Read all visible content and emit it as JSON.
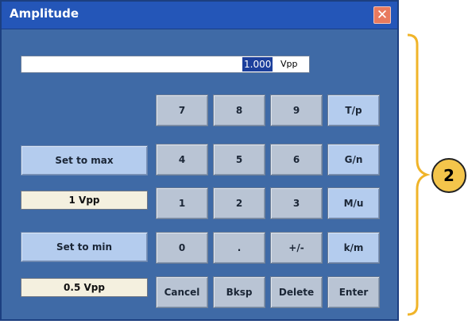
{
  "dialog": {
    "title": "Amplitude",
    "close_glyph": "✕",
    "input": {
      "value": "1.000",
      "unit": "Vpp"
    },
    "keypad": {
      "row1": [
        "7",
        "8",
        "9"
      ],
      "row2": [
        "4",
        "5",
        "6"
      ],
      "row3": [
        "1",
        "2",
        "3"
      ],
      "row4": [
        "0",
        ".",
        "+/-"
      ],
      "units": [
        "T/p",
        "G/n",
        "M/u",
        "k/m"
      ],
      "actions": [
        "Cancel",
        "Bksp",
        "Delete",
        "Enter"
      ]
    },
    "side": {
      "set_max_label": "Set to max",
      "max_value": "1 Vpp",
      "set_min_label": "Set to min",
      "min_value": "0.5 Vpp"
    }
  },
  "callout": {
    "number": "2",
    "color": "#f4c54b"
  }
}
